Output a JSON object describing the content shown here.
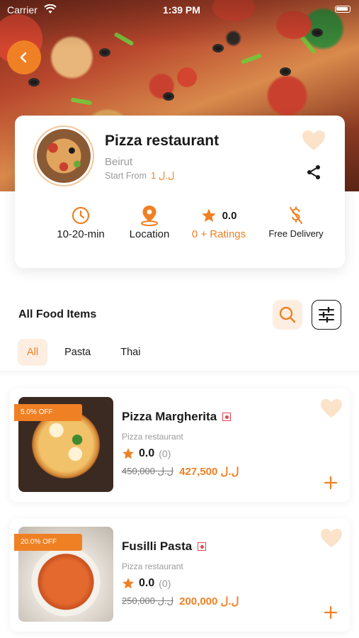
{
  "status_bar": {
    "carrier": "Carrier",
    "time": "1:39 PM"
  },
  "colors": {
    "accent": "#f08024",
    "accent_light": "#fdeee1",
    "muted": "#9a9a9a"
  },
  "restaurant": {
    "name": "Pizza restaurant",
    "city": "Beirut",
    "start_from_label": "Start From",
    "start_from_price": "1 ل.ل",
    "stats": {
      "time": "10-20-min",
      "location": "Location",
      "rating_value": "0.0",
      "ratings_label": "0 + Ratings",
      "delivery": "Free Delivery"
    }
  },
  "section": {
    "title": "All Food Items"
  },
  "tabs": [
    {
      "label": "All",
      "active": true
    },
    {
      "label": "Pasta",
      "active": false
    },
    {
      "label": "Thai",
      "active": false
    }
  ],
  "food_items": [
    {
      "name": "Pizza Margherita",
      "discount": "5.0% OFF",
      "restaurant": "Pizza restaurant",
      "rating": "0.0",
      "rating_count": "(0)",
      "old_price": "450,000 ل.ل",
      "new_price": "427,500 ل.ل"
    },
    {
      "name": "Fusilli Pasta",
      "discount": "20.0% OFF",
      "restaurant": "Pizza restaurant",
      "rating": "0.0",
      "rating_count": "(0)",
      "old_price": "250,000 ل.ل",
      "new_price": "200,000 ل.ل"
    }
  ],
  "icons": {
    "back": "chevron-left-icon",
    "heart": "heart-icon",
    "share": "share-icon",
    "clock": "clock-icon",
    "location": "location-pin-icon",
    "star": "star-icon",
    "delivery": "free-delivery-icon",
    "search": "search-icon",
    "filter": "filter-sliders-icon",
    "add": "plus-icon"
  }
}
